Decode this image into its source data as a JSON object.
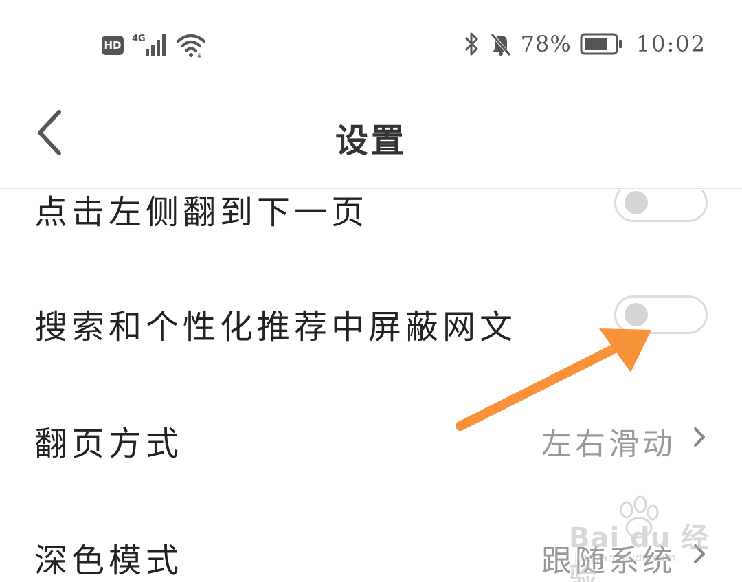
{
  "status_bar": {
    "hd_label": "HD",
    "network_label": "4G",
    "battery_percent": "78%",
    "battery_level": 0.78,
    "time": "10:02",
    "icons": [
      "hd-icon",
      "signal-4g-icon",
      "wifi-icon",
      "bluetooth-icon",
      "mute-bell-icon",
      "battery-icon"
    ]
  },
  "header": {
    "title": "设置",
    "back_icon": "chevron-left-icon"
  },
  "settings": {
    "items": [
      {
        "label": "点击左侧翻到下一页",
        "type": "toggle",
        "on": false
      },
      {
        "label": "搜索和个性化推荐中屏蔽网文",
        "type": "toggle",
        "on": false
      },
      {
        "label": "翻页方式",
        "type": "select",
        "value": "左右滑动"
      },
      {
        "label": "深色模式",
        "type": "select",
        "value": "跟随系统"
      }
    ]
  },
  "watermark": {
    "text": "Bai du 经验",
    "sub": "jingyan.baidu.com"
  },
  "colors": {
    "annotation_arrow": "#f7923a",
    "toggle_border": "#dcdcdc",
    "toggle_knob": "#d6d6d6",
    "value_text": "#999999"
  }
}
